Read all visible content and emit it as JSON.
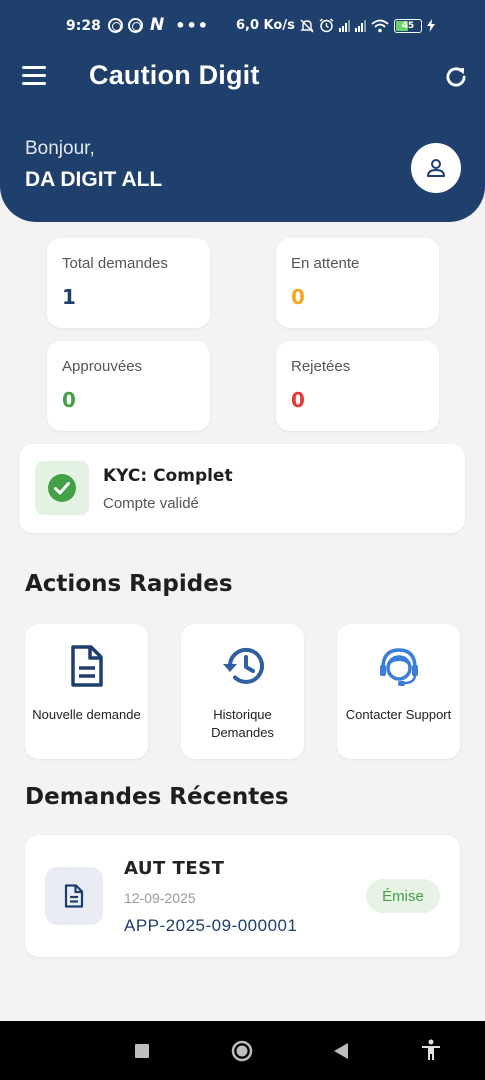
{
  "status_bar": {
    "time": "9:28",
    "network_speed": "6,0 Ko/s",
    "battery_level": "45",
    "icons": [
      "target-icon",
      "target-icon",
      "n-app-icon",
      "more-dots-icon",
      "mute-icon",
      "alarm-icon",
      "signal-icon",
      "signal-icon",
      "wifi-icon",
      "battery-icon",
      "charging-icon"
    ]
  },
  "app_bar": {
    "title": "Caution Digit",
    "menu_icon": "menu-icon",
    "refresh_icon": "refresh-icon"
  },
  "greeting": {
    "hello": "Bonjour,",
    "name": "DA DIGIT ALL",
    "avatar_icon": "person-icon"
  },
  "stats": [
    {
      "label": "Total demandes",
      "value": "1",
      "color": "#1f3f6d"
    },
    {
      "label": "En attente",
      "value": "0",
      "color": "#f5a623"
    },
    {
      "label": "Approuvées",
      "value": "0",
      "color": "#43a047"
    },
    {
      "label": "Rejetées",
      "value": "0",
      "color": "#e53935"
    }
  ],
  "kyc": {
    "title": "KYC: Complet",
    "subtitle": "Compte validé",
    "icon": "check-circle-icon",
    "color": "#43a047"
  },
  "quick_actions": {
    "title": "Actions Rapides",
    "items": [
      {
        "label": "Nouvelle demande",
        "icon": "document-icon",
        "color": "#1f3f6d"
      },
      {
        "label": "Historique Demandes",
        "icon": "history-icon",
        "color": "#2f5f9e"
      },
      {
        "label": "Contacter Support",
        "icon": "support-agent-icon",
        "color": "#3b7dd8"
      }
    ]
  },
  "recent_requests": {
    "title": "Demandes Récentes",
    "items": [
      {
        "title": "AUT TEST",
        "date": "12-09-2025",
        "id": "APP-2025-09-000001",
        "status": "Émise",
        "icon": "document-icon"
      }
    ]
  },
  "nav_bar": {
    "buttons": [
      "recents-square-icon",
      "home-circle-icon",
      "back-triangle-icon",
      "accessibility-icon"
    ]
  }
}
